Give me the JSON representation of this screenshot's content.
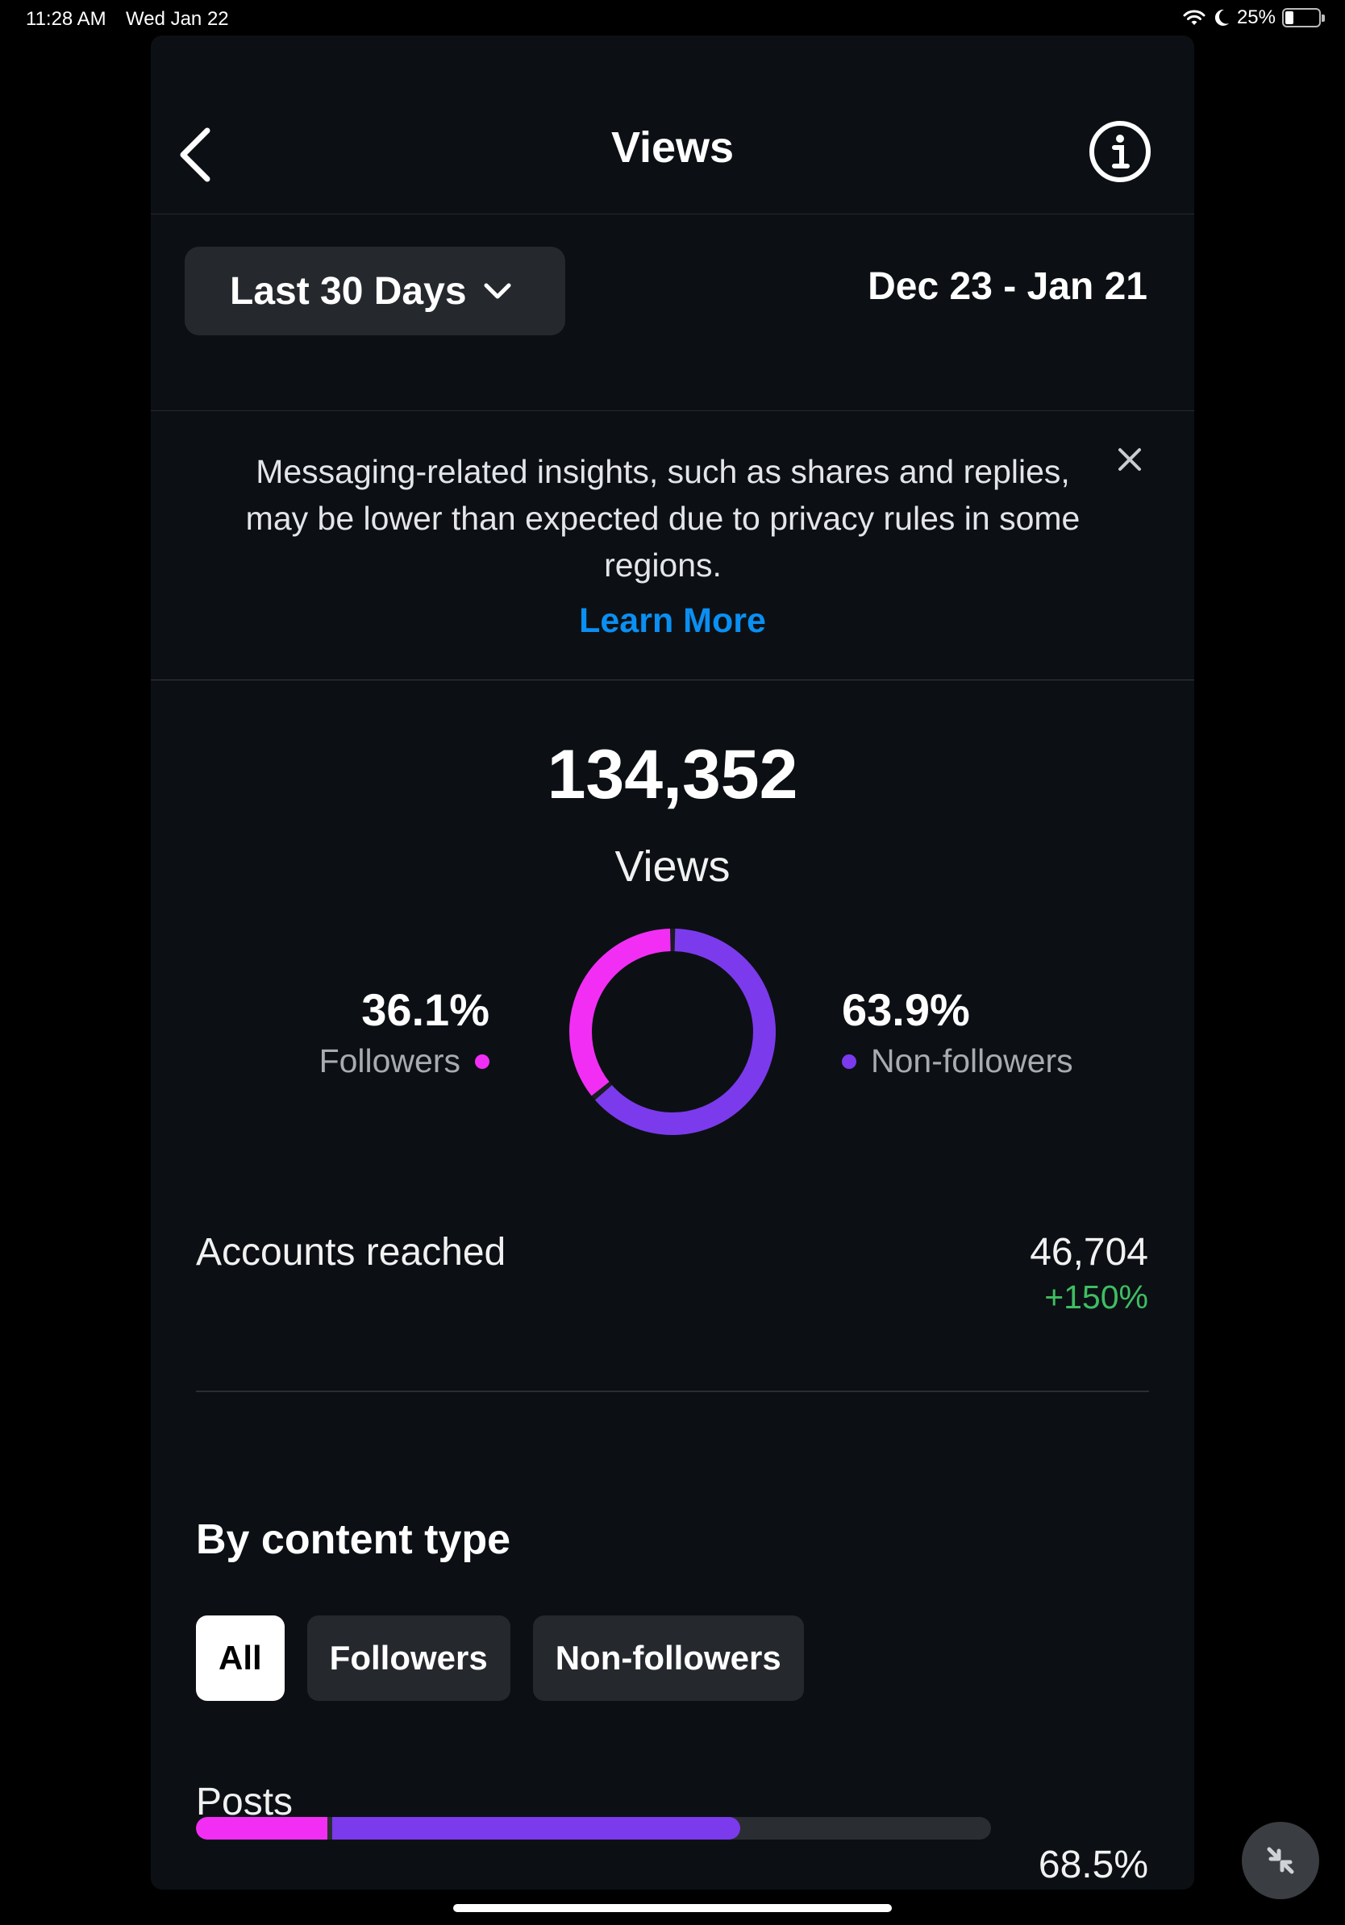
{
  "status_bar": {
    "time": "11:28 AM",
    "date": "Wed Jan 22",
    "battery": "25%",
    "battery_level": 0.25,
    "icons": [
      "wifi-icon",
      "moon-icon",
      "battery-icon"
    ]
  },
  "header": {
    "title": "Views",
    "back_icon": "chevron-left-icon",
    "info_icon": "info-icon"
  },
  "range": {
    "selected": "Last 30 Days",
    "dates": "Dec 23 - Jan 21"
  },
  "notice": {
    "text": "Messaging-related insights, such as shares and replies, may be lower than expected due to privacy rules in some regions.",
    "link": "Learn More"
  },
  "summary": {
    "total": "134,352",
    "label": "Views",
    "followers": {
      "value": "36.1%",
      "label": "Followers",
      "fraction": 0.361
    },
    "non_followers": {
      "value": "63.9%",
      "label": "Non-followers",
      "fraction": 0.639
    }
  },
  "reach": {
    "label": "Accounts reached",
    "value": "46,704",
    "change": "+150%"
  },
  "content_type": {
    "title": "By content type",
    "filters": [
      "All",
      "Followers",
      "Non-followers"
    ],
    "active_filter": "All",
    "rows": [
      {
        "label": "Posts",
        "value": "68.5%",
        "followers_fraction": 0.165,
        "non_followers_fraction": 0.52
      }
    ]
  },
  "colors": {
    "followers": "#f22ef5",
    "non_followers": "#7c3aed",
    "link": "#0a8ff3",
    "positive": "#3fbd63",
    "background": "#0c1014"
  }
}
